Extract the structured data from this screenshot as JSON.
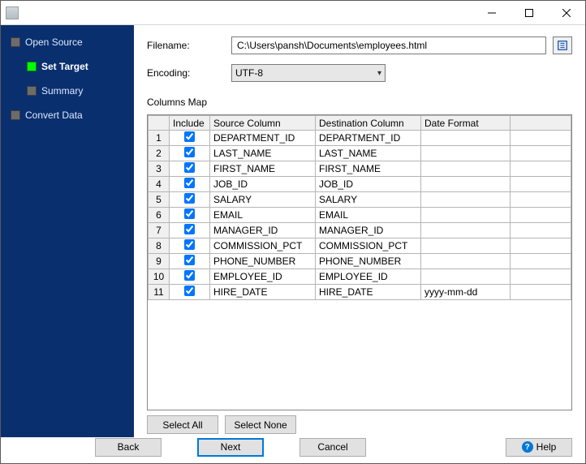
{
  "sidebar": {
    "steps": [
      {
        "label": "Open Source"
      },
      {
        "label": "Set Target"
      },
      {
        "label": "Summary"
      },
      {
        "label": "Convert Data"
      }
    ]
  },
  "form": {
    "filename_label": "Filename:",
    "filename_value": "C:\\Users\\pansh\\Documents\\employees.html",
    "encoding_label": "Encoding:",
    "encoding_value": "UTF-8",
    "columns_map_label": "Columns Map"
  },
  "grid": {
    "headers": {
      "include": "Include",
      "source": "Source Column",
      "dest": "Destination Column",
      "fmt": "Date Format"
    },
    "rows": [
      {
        "n": "1",
        "inc": true,
        "src": "DEPARTMENT_ID",
        "dst": "DEPARTMENT_ID",
        "fmt": ""
      },
      {
        "n": "2",
        "inc": true,
        "src": "LAST_NAME",
        "dst": "LAST_NAME",
        "fmt": ""
      },
      {
        "n": "3",
        "inc": true,
        "src": "FIRST_NAME",
        "dst": "FIRST_NAME",
        "fmt": ""
      },
      {
        "n": "4",
        "inc": true,
        "src": "JOB_ID",
        "dst": "JOB_ID",
        "fmt": ""
      },
      {
        "n": "5",
        "inc": true,
        "src": "SALARY",
        "dst": "SALARY",
        "fmt": ""
      },
      {
        "n": "6",
        "inc": true,
        "src": "EMAIL",
        "dst": "EMAIL",
        "fmt": ""
      },
      {
        "n": "7",
        "inc": true,
        "src": "MANAGER_ID",
        "dst": "MANAGER_ID",
        "fmt": ""
      },
      {
        "n": "8",
        "inc": true,
        "src": "COMMISSION_PCT",
        "dst": "COMMISSION_PCT",
        "fmt": ""
      },
      {
        "n": "9",
        "inc": true,
        "src": "PHONE_NUMBER",
        "dst": "PHONE_NUMBER",
        "fmt": ""
      },
      {
        "n": "10",
        "inc": true,
        "src": "EMPLOYEE_ID",
        "dst": "EMPLOYEE_ID",
        "fmt": ""
      },
      {
        "n": "11",
        "inc": true,
        "src": "HIRE_DATE",
        "dst": "HIRE_DATE",
        "fmt": "yyyy-mm-dd"
      }
    ]
  },
  "buttons": {
    "select_all": "Select All",
    "select_none": "Select None",
    "back": "Back",
    "next": "Next",
    "cancel": "Cancel",
    "help": "Help"
  }
}
